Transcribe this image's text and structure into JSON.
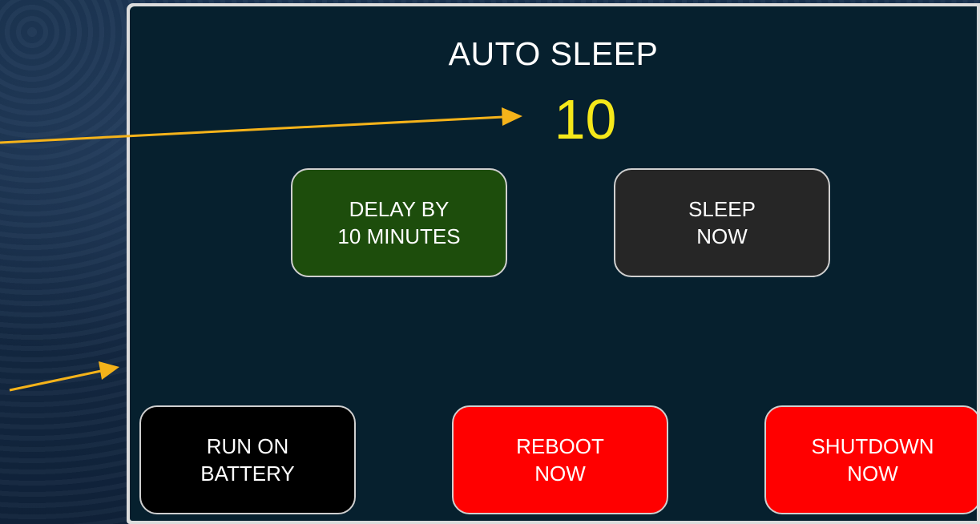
{
  "panel": {
    "title": "AUTO SLEEP",
    "counter": "10"
  },
  "buttons": {
    "delay": {
      "line1": "DELAY BY",
      "line2": "10 MINUTES",
      "color": "#1d4d0c"
    },
    "sleep": {
      "line1": "SLEEP",
      "line2": "NOW",
      "color": "#262626"
    },
    "battery": {
      "line1": "RUN ON",
      "line2": "BATTERY",
      "color": "#000000"
    },
    "reboot": {
      "line1": "REBOOT",
      "line2": "NOW",
      "color": "#ff0000"
    },
    "shutdown": {
      "line1": "SHUTDOWN",
      "line2": "NOW",
      "color": "#ff0000"
    }
  },
  "annotations": {
    "arrow_color": "#f5b31a",
    "icon": "arrow-icon"
  },
  "colors": {
    "panel_background": "#06202e",
    "counter": "#f5e81a",
    "text": "#ffffff"
  }
}
